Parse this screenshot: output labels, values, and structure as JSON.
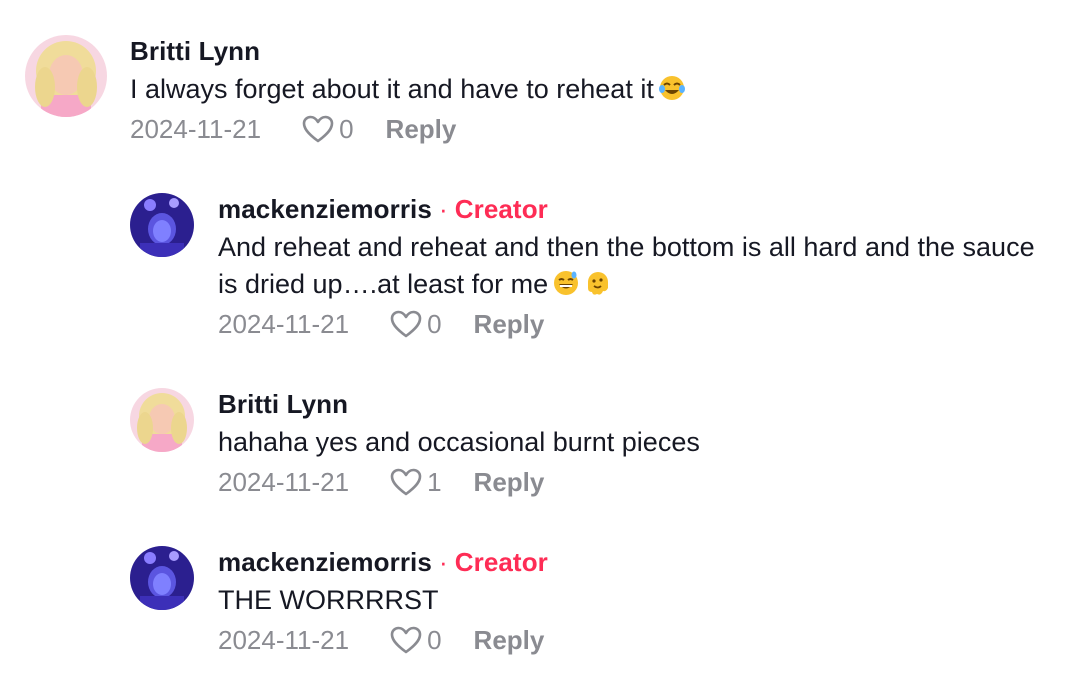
{
  "comments": [
    {
      "author": "Britti Lynn",
      "text": "I always forget about it and have to reheat it",
      "emoji": [
        "tears-of-joy-emoji"
      ],
      "date": "2024-11-21",
      "likes": "0",
      "reply_label": "Reply",
      "avatar": "britti-avatar"
    },
    {
      "author": "mackenziemorris",
      "separator": "·",
      "badge": "Creator",
      "text": "And reheat and reheat and then the bottom is all hard and the sauce is dried up….at least for me",
      "emoji": [
        "grinning-sweat-emoji",
        "melting-face-emoji"
      ],
      "date": "2024-11-21",
      "likes": "0",
      "reply_label": "Reply",
      "avatar": "mackenzie-avatar"
    },
    {
      "author": "Britti Lynn",
      "text": "hahaha yes and occasional burnt pieces",
      "date": "2024-11-21",
      "likes": "1",
      "reply_label": "Reply",
      "avatar": "britti-avatar"
    },
    {
      "author": "mackenziemorris",
      "separator": "·",
      "badge": "Creator",
      "text": "THE WORRRRST",
      "date": "2024-11-21",
      "likes": "0",
      "reply_label": "Reply",
      "avatar": "mackenzie-avatar"
    }
  ],
  "colors": {
    "creator_badge": "#fe2c55",
    "meta_text": "#8a8b91",
    "primary_text": "#161823"
  }
}
